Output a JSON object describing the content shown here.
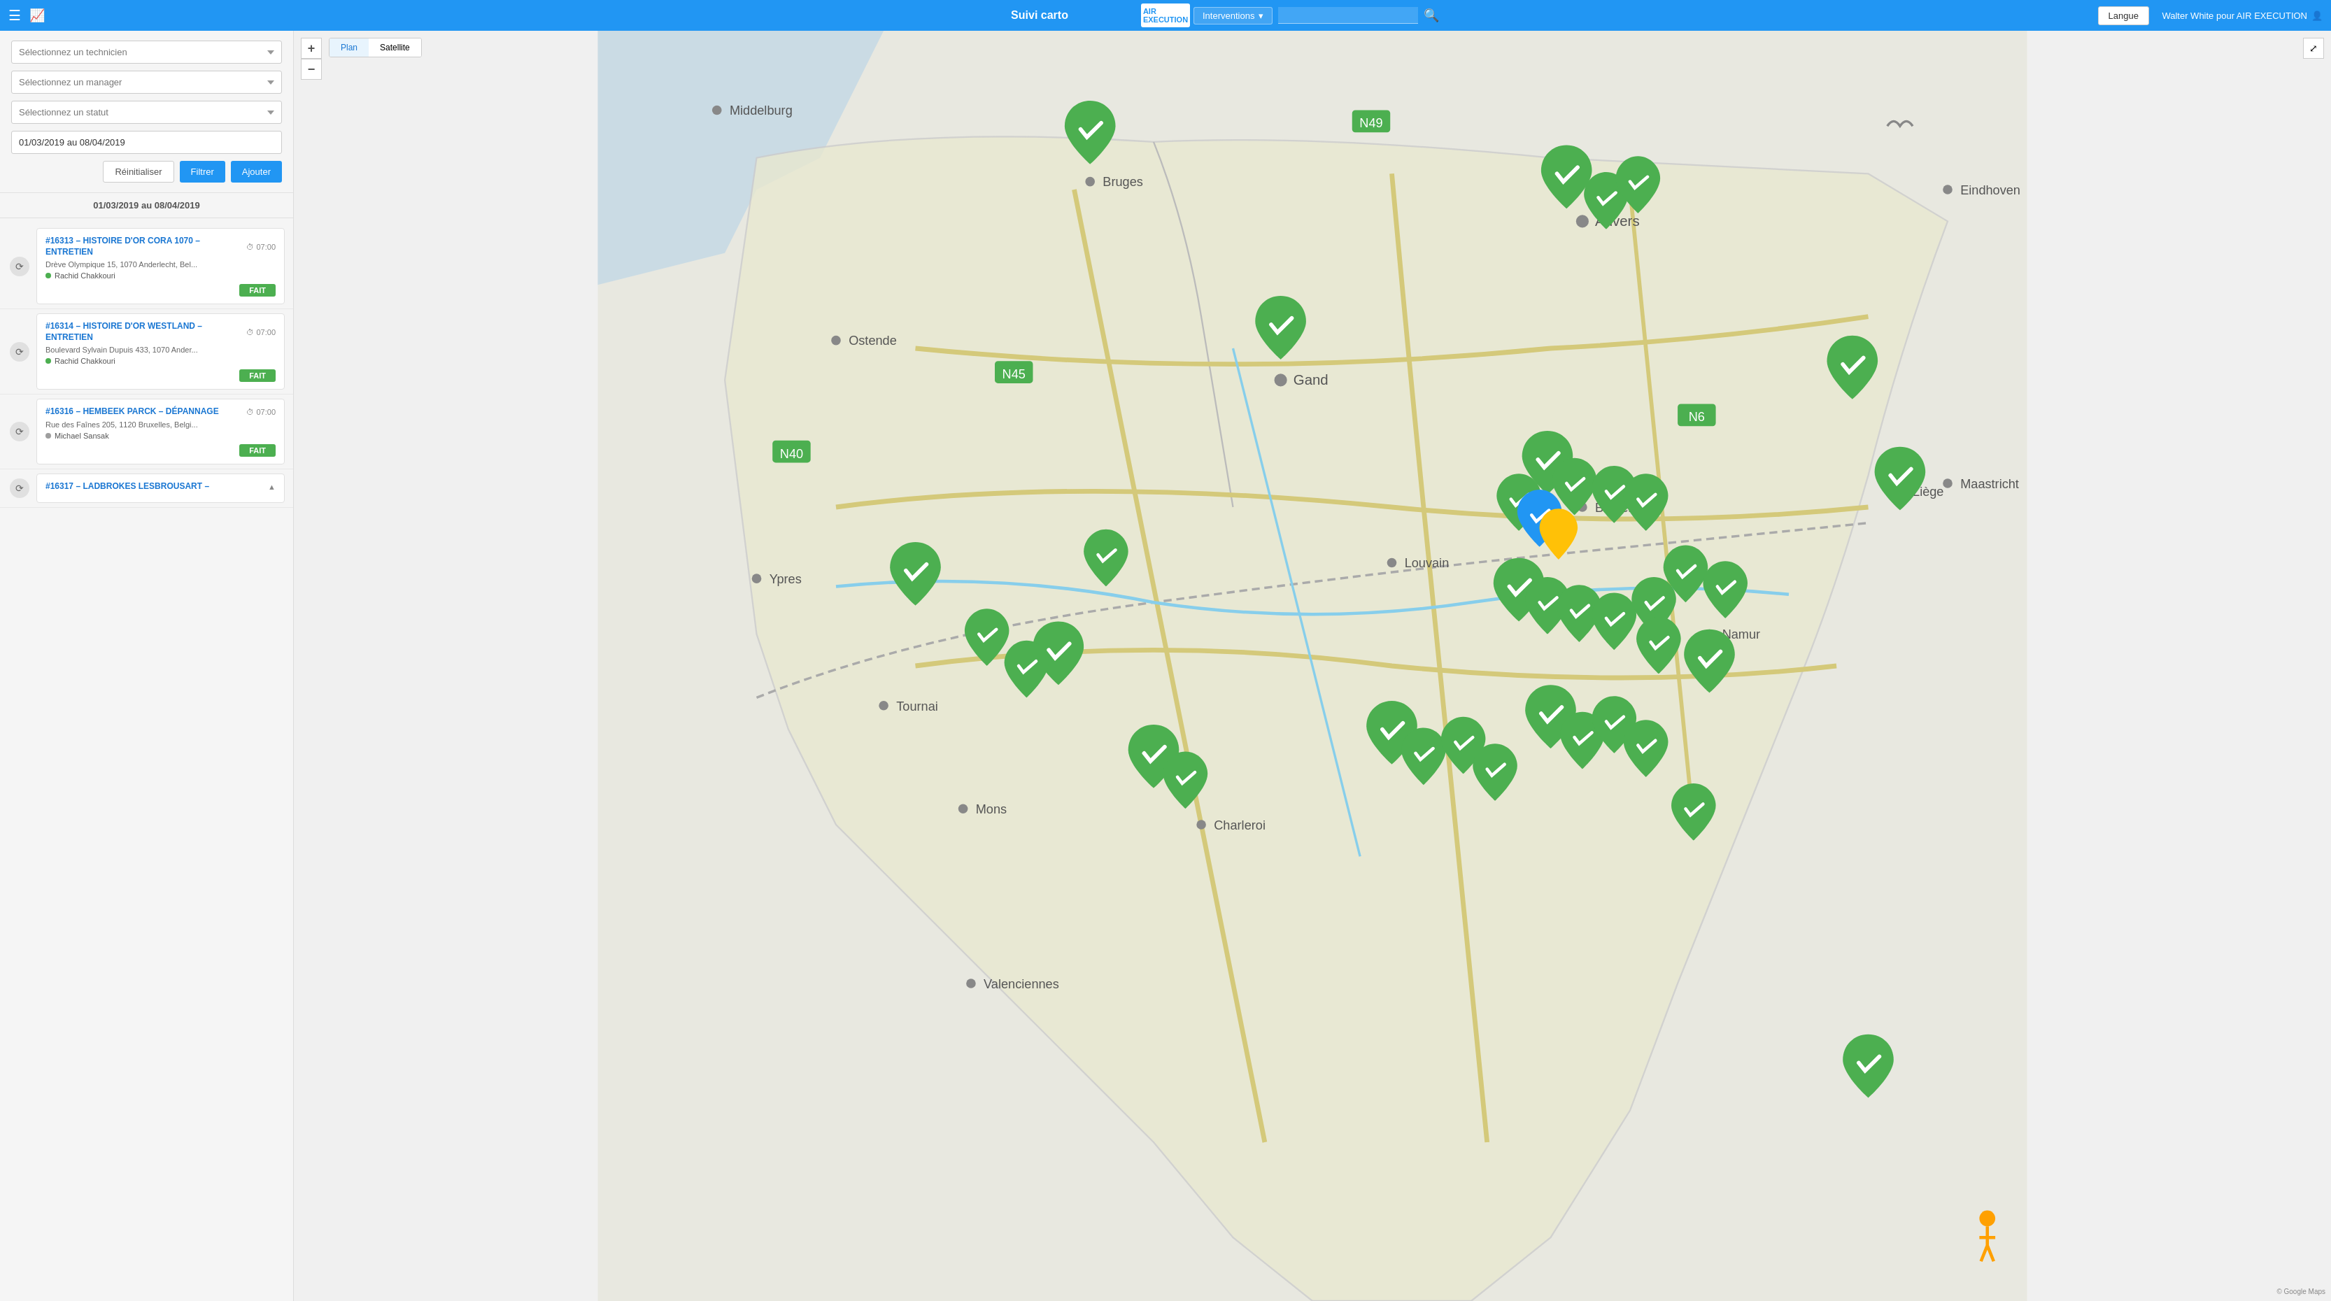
{
  "topnav": {
    "hamburger_icon": "☰",
    "chart_icon": "📈",
    "title": "Suivi carto",
    "logo_line1": "AIR",
    "logo_line2": "EXECUTION",
    "interventions_label": "Interventions",
    "dropdown_arrow": "▾",
    "search_placeholder": "",
    "search_icon": "🔍",
    "langue_label": "Langue",
    "user_label": "Walter White pour AIR EXECUTION",
    "user_icon": "👤"
  },
  "sidebar": {
    "technician_placeholder": "Sélectionnez un technicien",
    "manager_placeholder": "Sélectionnez un manager",
    "status_placeholder": "Sélectionnez un statut",
    "date_value": "01/03/2019 au 08/04/2019",
    "reset_label": "Réinitialiser",
    "filter_label": "Filtrer",
    "add_label": "Ajouter",
    "date_range_heading": "01/03/2019 au 08/04/2019",
    "interventions": [
      {
        "id": "#16313",
        "title": "#16313 – HISTOIRE D'OR CORA 1070 – ENTRETIEN",
        "time": "07:00",
        "address": "Drève Olympique 15, 1070 Anderlecht, Bel...",
        "technician": "Rachid Chakkouri",
        "tech_dot": "green",
        "status": "FAIT"
      },
      {
        "id": "#16314",
        "title": "#16314 – HISTOIRE D'OR WESTLAND – ENTRETIEN",
        "time": "07:00",
        "address": "Boulevard Sylvain Dupuis 433, 1070 Ander...",
        "technician": "Rachid Chakkouri",
        "tech_dot": "green",
        "status": "FAIT"
      },
      {
        "id": "#16316",
        "title": "#16316 – HEMBEEK PARCK – DÉPANNAGE",
        "time": "07:00",
        "address": "Rue des Faînes 205, 1120 Bruxelles, Belgi...",
        "technician": "Michael Sansak",
        "tech_dot": "gray",
        "status": "FAIT"
      },
      {
        "id": "#16317",
        "title": "#16317 – LADBROKES LESBROUSART –",
        "time": "",
        "address": "",
        "technician": "",
        "tech_dot": "gray",
        "status": ""
      }
    ]
  },
  "map": {
    "tab_plan": "Plan",
    "tab_satellite": "Satellite",
    "zoom_in": "+",
    "zoom_out": "−",
    "fullscreen_icon": "⤢"
  }
}
